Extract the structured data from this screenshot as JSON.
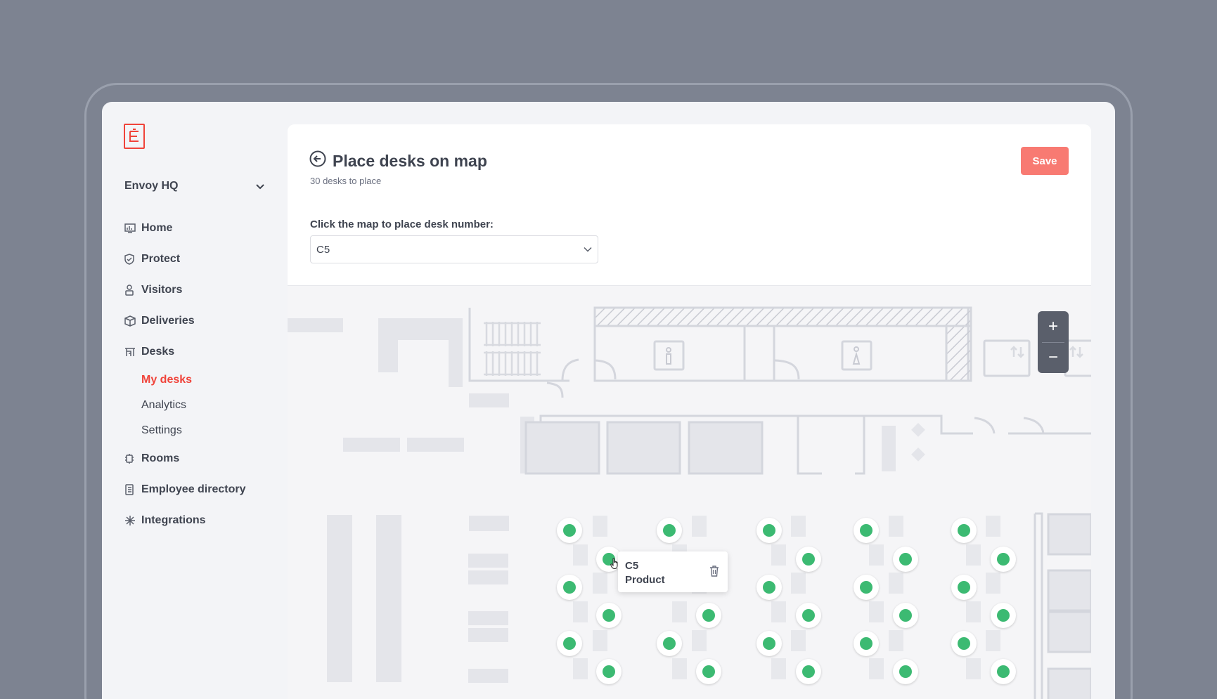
{
  "sidebar": {
    "location": "Envoy HQ",
    "nav": [
      {
        "label": "Home",
        "icon": "chart-icon"
      },
      {
        "label": "Protect",
        "icon": "shield-icon"
      },
      {
        "label": "Visitors",
        "icon": "visitor-icon"
      },
      {
        "label": "Deliveries",
        "icon": "package-icon"
      },
      {
        "label": "Desks",
        "icon": "desk-icon"
      }
    ],
    "desks_sub": [
      {
        "label": "My desks",
        "active": true
      },
      {
        "label": "Analytics",
        "active": false
      },
      {
        "label": "Settings",
        "active": false
      }
    ],
    "nav_bottom": [
      {
        "label": "Rooms",
        "icon": "rooms-icon"
      },
      {
        "label": "Employee directory",
        "icon": "directory-icon"
      },
      {
        "label": "Integrations",
        "icon": "integrations-icon"
      }
    ]
  },
  "header": {
    "title": "Place desks on map",
    "subtitle": "30 desks to place",
    "save_label": "Save"
  },
  "form": {
    "label": "Click the map to place desk number:",
    "selected_desk": "C5"
  },
  "zoom": {
    "plus": "+",
    "minus": "−"
  },
  "tooltip": {
    "name": "C5",
    "team": "Product"
  },
  "colors": {
    "accent": "#f0433a",
    "save": "#f87a72",
    "desk": "#3cba72"
  }
}
